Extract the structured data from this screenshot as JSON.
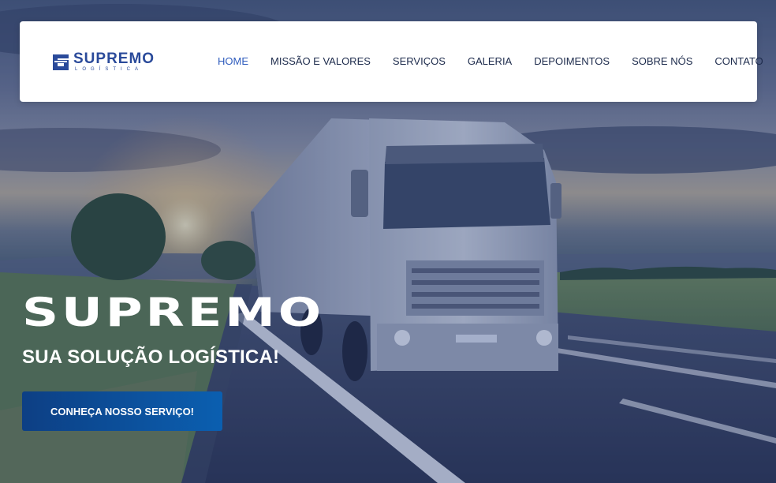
{
  "brand": {
    "name": "SUPREMO",
    "tagline": "LOGÍSTICA",
    "logo_icon": "supremo-s-logo-icon",
    "primary_color": "#2a4a9a"
  },
  "nav": {
    "items": [
      {
        "label": "HOME",
        "active": true
      },
      {
        "label": "MISSÃO E VALORES",
        "active": false
      },
      {
        "label": "SERVIÇOS",
        "active": false
      },
      {
        "label": "GALERIA",
        "active": false
      },
      {
        "label": "DEPOIMENTOS",
        "active": false
      },
      {
        "label": "SOBRE NÓS",
        "active": false
      },
      {
        "label": "CONTATO",
        "active": false
      }
    ],
    "active_color": "#2e5bbd",
    "text_color": "#1d2b4c"
  },
  "hero": {
    "title": "SUPREMO",
    "subtitle": "SUA SOLUÇÃO LOGÍSTICA!",
    "cta_label": "CONHEÇA NOSSO SERVIÇO!",
    "background_image": "truck-on-highway-at-sunset"
  }
}
